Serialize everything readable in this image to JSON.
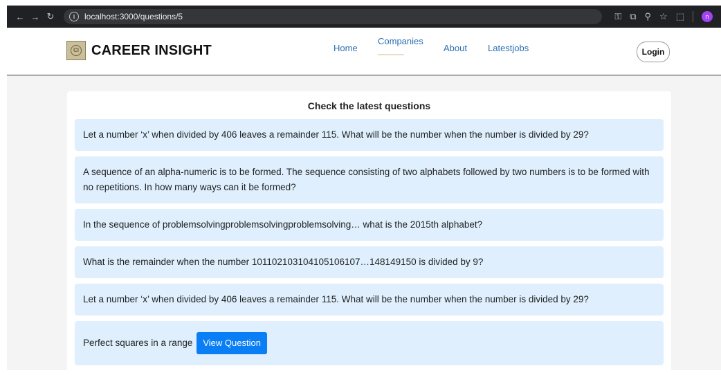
{
  "browser": {
    "url": "localhost:3000/questions/5",
    "profile_initial": "n"
  },
  "navbar": {
    "brand": "CAREER INSIGHT",
    "links": [
      "Home",
      "Companies",
      "About",
      "Latestjobs"
    ],
    "active_link": "Companies",
    "login_label": "Login"
  },
  "main": {
    "heading": "Check the latest questions",
    "questions": [
      "Let a number ‘x’ when divided by 406 leaves a remainder 115. What will be the number when the number is divided by 29?",
      "A sequence of an alpha-numeric is to be formed. The sequence consisting of two alphabets followed by two numbers is to be formed with no repetitions. In how many ways can it be formed?",
      "In the sequence of problemsolvingproblemsolvingproblemsolving… what is the 2015th alphabet?",
      "What is the remainder when the number 101102103104105106107…148149150 is divided by 9?",
      "Let a number ‘x’ when divided by 406 leaves a remainder 115. What will be the number when the number is divided by 29?"
    ],
    "last_item": {
      "text": "Perfect squares in a range",
      "button_label": "View Question"
    }
  },
  "colors": {
    "accent": "#0a7ef5",
    "question_bg": "#dfeffd",
    "nav_link": "#2a6fb0"
  }
}
